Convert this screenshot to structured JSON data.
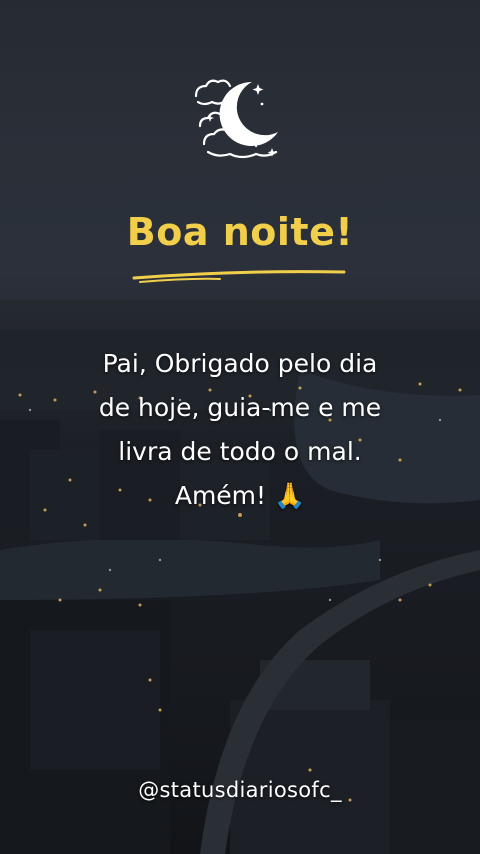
{
  "greeting": {
    "title": "Boa noite!",
    "title_color": "#f2cf4b"
  },
  "message": {
    "line1": "Pai, Obrigado pelo dia",
    "line2": "de hoje, guia-me e me",
    "line3": "livra de todo o mal.",
    "line4": "Amém! 🙏"
  },
  "footer": {
    "handle": "@statusdiariosofc_"
  },
  "icons": {
    "moon": "crescent-moon-clouds-icon",
    "hands": "praying-hands-emoji"
  }
}
